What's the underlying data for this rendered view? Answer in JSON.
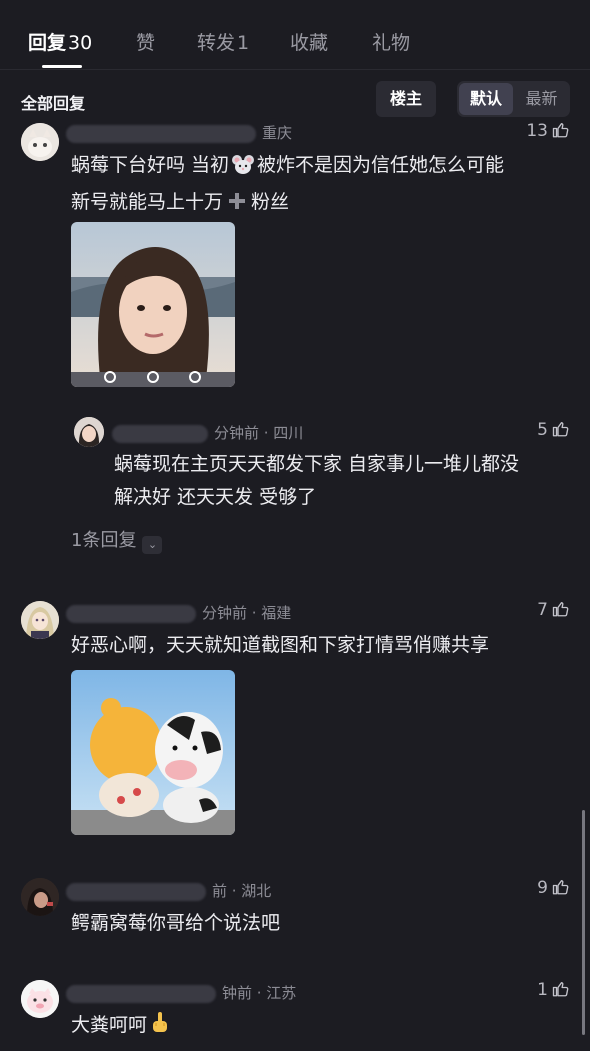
{
  "tabs": [
    {
      "label": "回复",
      "count": "30"
    },
    {
      "label": "赞",
      "count": ""
    },
    {
      "label": "转发",
      "count": "1"
    },
    {
      "label": "收藏",
      "count": ""
    },
    {
      "label": "礼物",
      "count": ""
    }
  ],
  "filter": {
    "all_replies": "全部回复",
    "op_button": "楼主",
    "sort_default": "默认",
    "sort_latest": "最新"
  },
  "comments": [
    {
      "meta": "重庆",
      "likes": "13",
      "text_line1": "蜗莓下台好吗 当初",
      "text_line1b": "被炸不是因为信任她怎么可能",
      "text_line2a": "新号就能马上十万",
      "text_line2b": "粉丝",
      "reply": {
        "meta": "分钟前 · 四川",
        "likes": "5",
        "text_line1": "蜗莓现在主页天天都发下家 自家事儿一堆儿都没",
        "text_line2": "解决好 还天天发 受够了"
      },
      "more_replies": "1条回复"
    },
    {
      "meta": "分钟前 · 福建",
      "likes": "7",
      "text": "好恶心啊，天天就知道截图和下家打情骂俏赚共享"
    },
    {
      "meta": "前 · 湖北",
      "likes": "9",
      "text": "鳄霸窝莓你哥给个说法吧"
    },
    {
      "meta": "钟前 · 江苏",
      "likes": "1",
      "text": "大粪呵呵"
    }
  ],
  "icons": {
    "like": "thumbs-up-icon",
    "mouse": "mouse-emoji-icon",
    "plus": "plus-emoji-icon",
    "finger": "middle-finger-emoji-icon",
    "expand": "chevron-down-icon"
  },
  "colors": {
    "background": "#1c1c22",
    "text": "#ececf0",
    "muted": "#8c8c95"
  }
}
